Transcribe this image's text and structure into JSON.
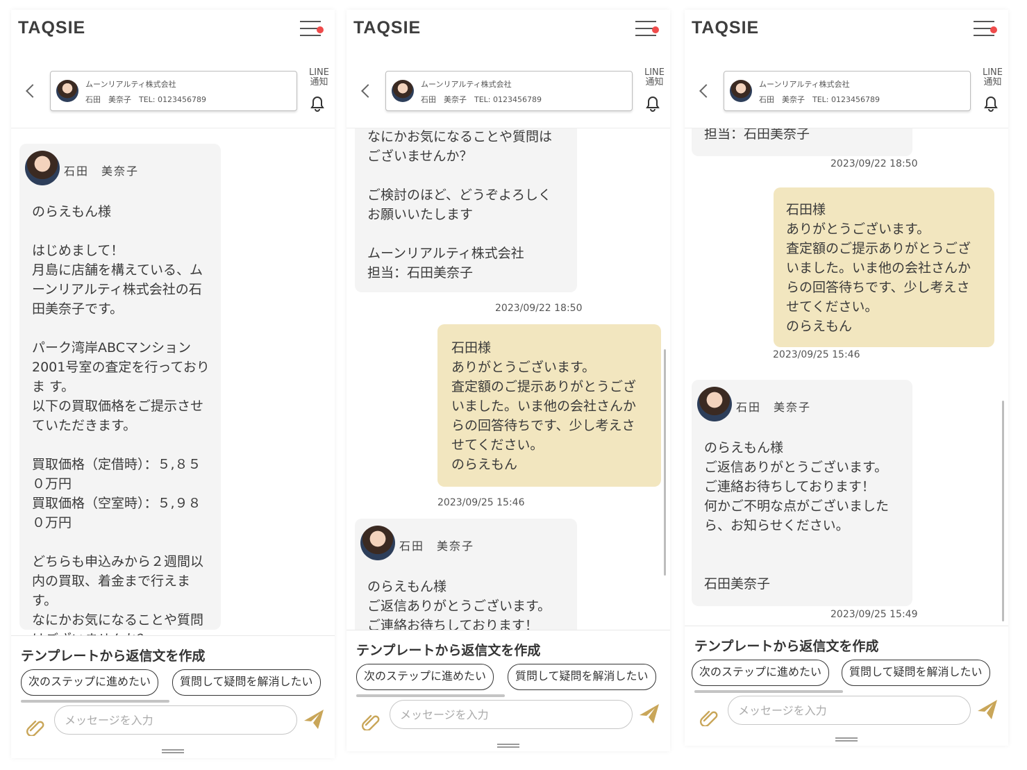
{
  "app": {
    "logo": "TAQSIE"
  },
  "contact": {
    "company": "ムーンリアルティ株式会社",
    "person": "石田　美奈子　TEL: 0123456789",
    "line_label_1": "LINE",
    "line_label_2": "通知"
  },
  "agent": {
    "name": "石田　美奈子"
  },
  "messages": {
    "agent_first_full": "のらえもん様\n\nはじめまして！\n月島に店舗を構えている、ムーンリアルティ株式会社の石田美奈子です。\n\nパーク湾岸ABCマンション2001号室の査定を行っておりま す。\n以下の買取価格をご提示させていただきます。\n\n買取価格（定借時）：５,８５０万円\n買取価格（空室時）：５,９８０万円\n\nどちらも申込みから２週間以内の買取、着金まで行えます。\nなにかお気になることや質問はございませんか？",
    "agent_first_tail": "なにかお気になることや質問はございませんか？\n\nご検討のほど、どうぞよろしくお願いいたします\n\nムーンリアルティ株式会社\n担当：石田美奈子",
    "agent_first_last_line": "担当：石田美奈子",
    "agent_first_time": "2023/09/22 18:50",
    "user_reply": "石田様\nありがとうございます。\n査定額のご提示ありがとうございました。いま他の会社さんからの回答待ちです、少し考えさせてください。\nのらえもん",
    "user_reply_time": "2023/09/25 15:46",
    "agent_second_full": "のらえもん様\nご返信ありがとうございます。\nご連絡お待ちしております！\n何かご不明な点がございましたら、お知らせください。\n\n\n石田美奈子",
    "agent_second_partial": "のらえもん様\nご返信ありがとうございます。\nご連絡お待ちしております！",
    "agent_second_time": "2023/09/25 15:49"
  },
  "composer": {
    "title": "テンプレートから返信文を作成",
    "chip_1": "次のステップに進めたい",
    "chip_2": "質問して疑問を解消したい",
    "placeholder": "メッセージを入力"
  },
  "colors": {
    "accent_gold": "#c9a659",
    "user_bubble": "#f2e6bf",
    "agent_bubble": "#f4f4f4",
    "notification_dot": "#ef4b4b"
  },
  "icons": [
    "menu-icon",
    "back-icon",
    "bell-icon",
    "paperclip-icon",
    "send-icon",
    "avatar"
  ]
}
